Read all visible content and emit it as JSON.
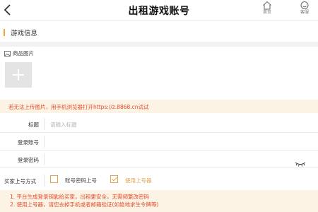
{
  "header": {
    "title": "出租游戏账号",
    "home_label": "首页",
    "service_label": "客服"
  },
  "section": {
    "title": "游戏信息"
  },
  "product_image": {
    "label": "商品图片"
  },
  "notice": "若无法上传图片，用手机浏览器打开https://z.8868.cn试试",
  "form": {
    "title_label": "标题",
    "title_placeholder": "请输入标题",
    "account_label": "登录账号",
    "password_label": "登录密码"
  },
  "login_method": {
    "label": "买家上号方式",
    "option1": "账号密码上号",
    "option2": "使用上号器",
    "selected": "使用上号器"
  },
  "tips": [
    "1. 平台生成登录钥匙给买家，出租更安全，无需频繁改密码",
    "2. 使用上号器，请您去掉手机或者邮箱验证(如绝地求生令牌等)"
  ],
  "colors": {
    "accent": "#e6a34a",
    "warning_text": "#e34b2c",
    "notice_bg": "#fcf3e4"
  }
}
